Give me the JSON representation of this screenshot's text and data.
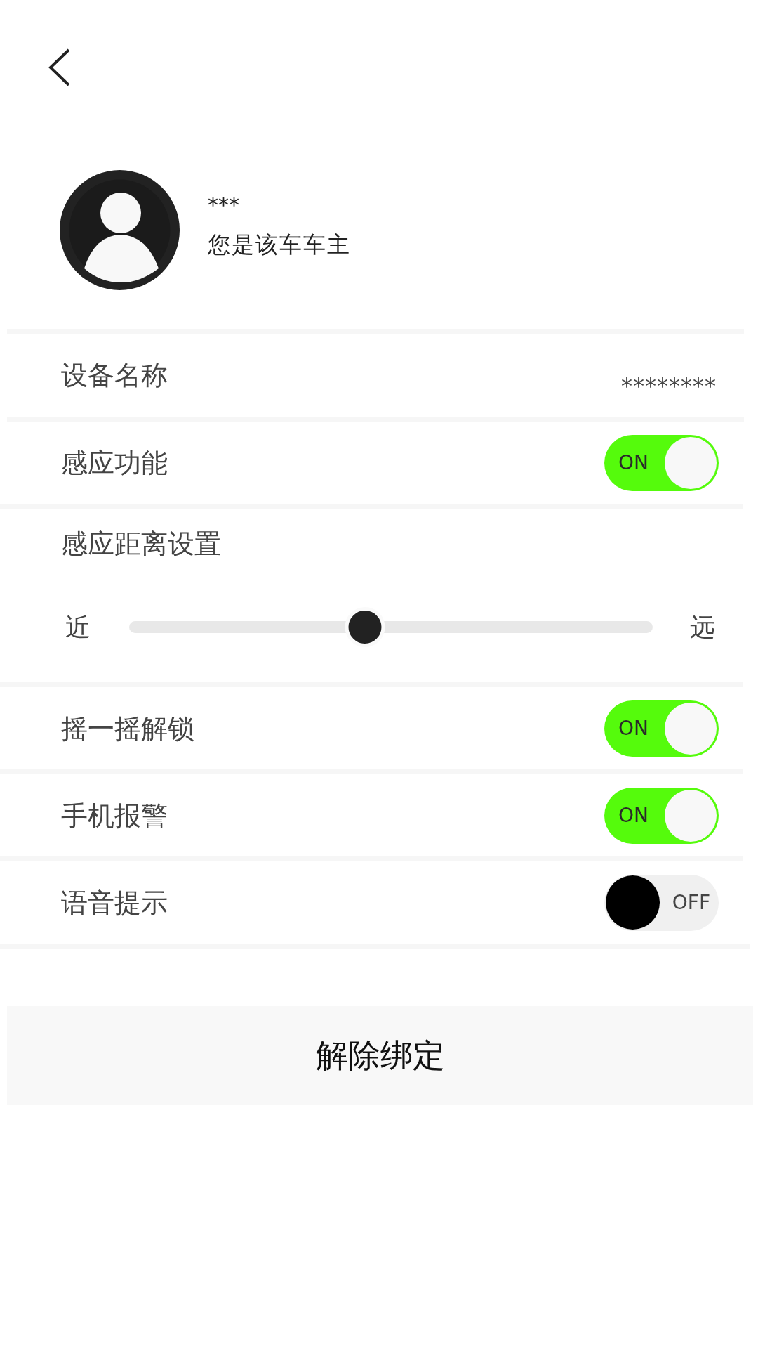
{
  "profile": {
    "name": "***",
    "role": "您是该车车主"
  },
  "settings": [
    {
      "kind": "value",
      "label": "设备名称",
      "value": "********"
    },
    {
      "kind": "toggle",
      "label": "感应功能",
      "on": true,
      "state_label": "ON"
    },
    {
      "kind": "slider",
      "label": "感应距离设置",
      "min_label": "近",
      "max_label": "远",
      "level": 0.45
    },
    {
      "kind": "toggle",
      "label": "摇一摇解锁",
      "on": true,
      "state_label": "ON"
    },
    {
      "kind": "toggle",
      "label": "手机报警",
      "on": true,
      "state_label": "ON"
    },
    {
      "kind": "toggle",
      "label": "语音提示",
      "on": false,
      "state_label": "OFF"
    }
  ],
  "unbind_button": {
    "label": "解除绑定"
  }
}
